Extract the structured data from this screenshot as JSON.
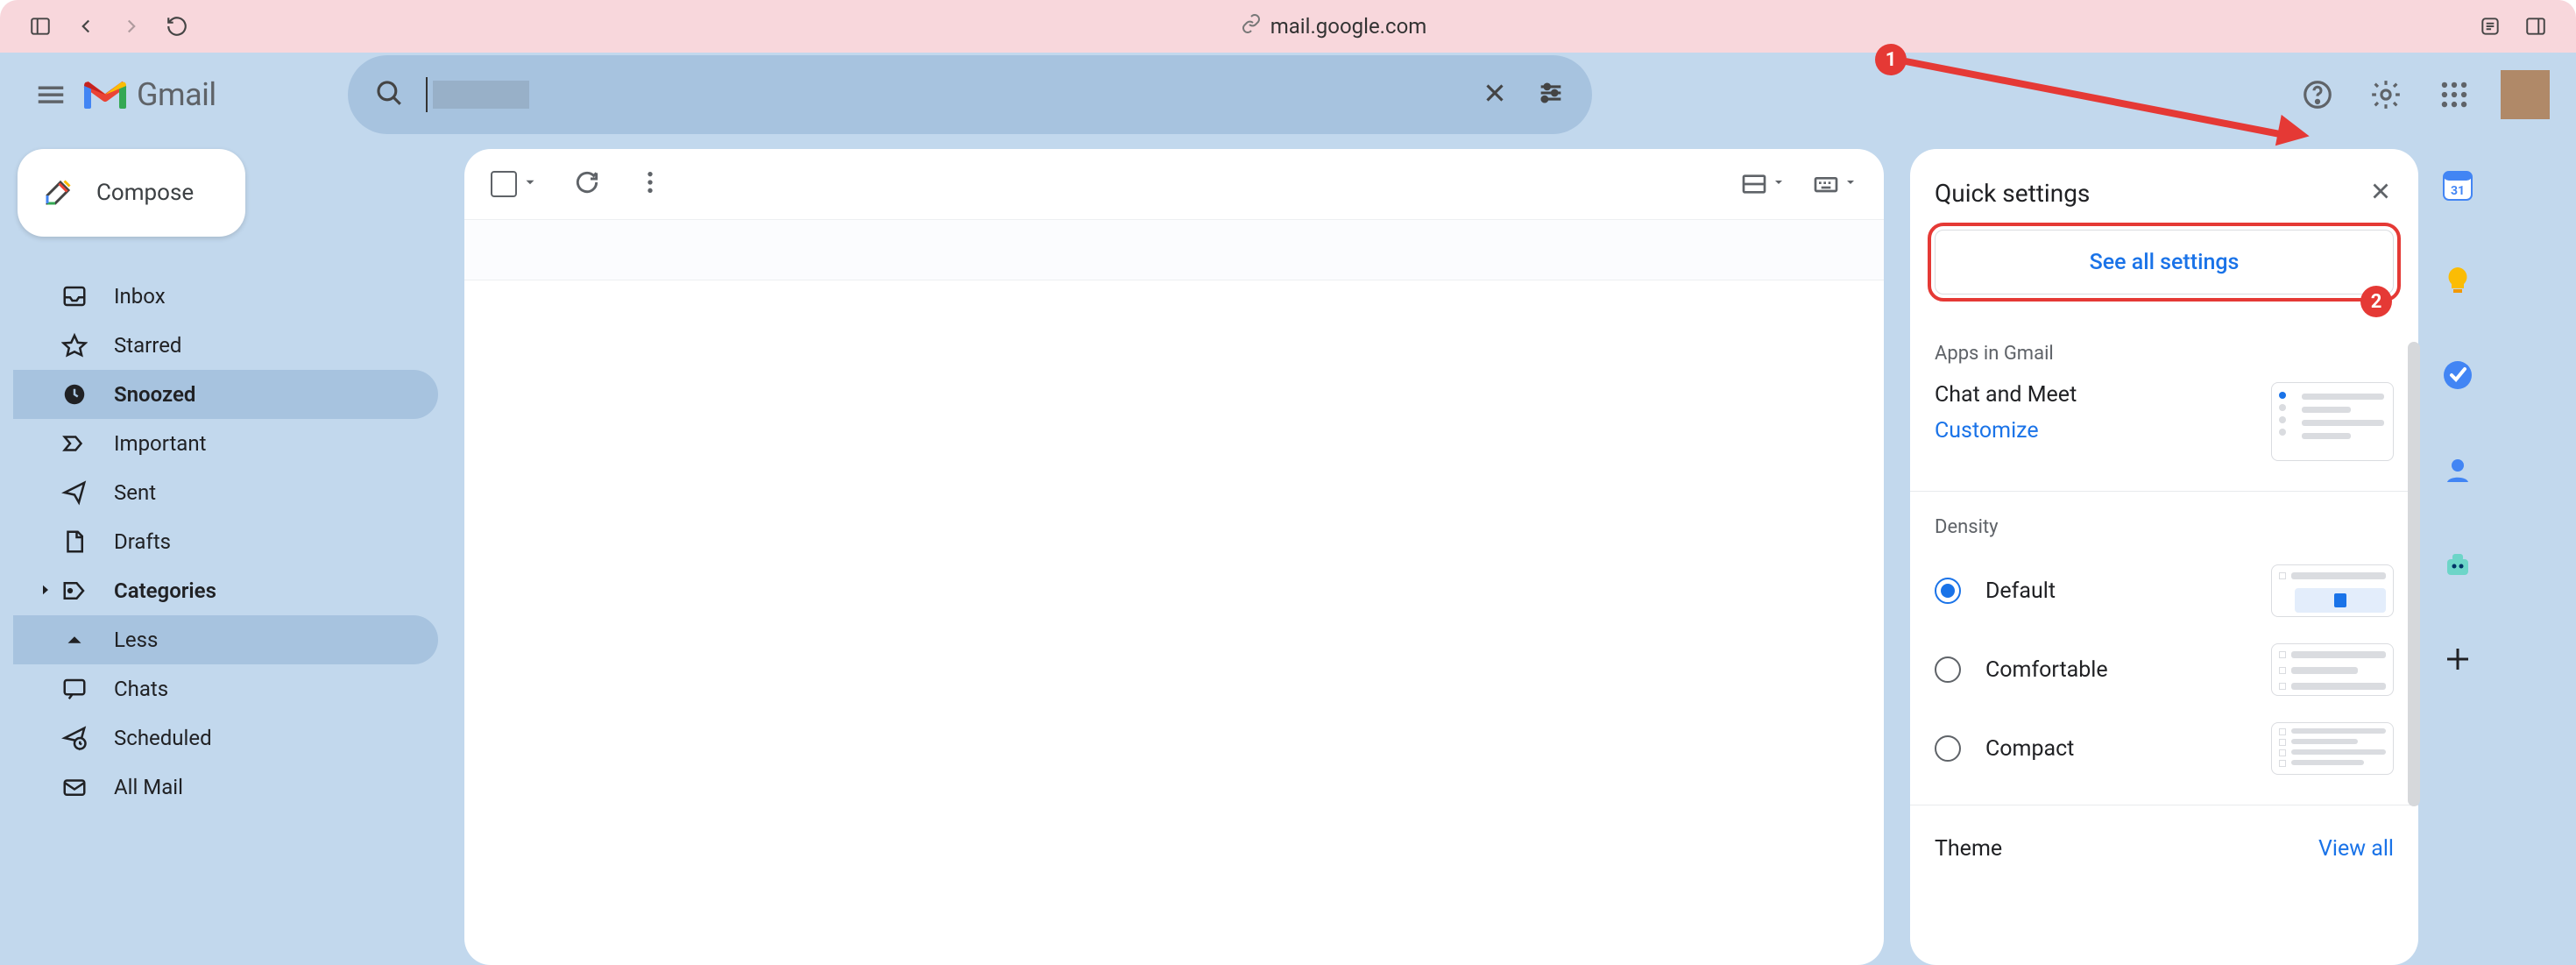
{
  "browser": {
    "url_domain": "mail.google.com"
  },
  "app": {
    "name": "Gmail"
  },
  "compose": {
    "label": "Compose"
  },
  "nav": {
    "items": [
      {
        "label": "Inbox"
      },
      {
        "label": "Starred"
      },
      {
        "label": "Snoozed"
      },
      {
        "label": "Important"
      },
      {
        "label": "Sent"
      },
      {
        "label": "Drafts"
      },
      {
        "label": "Categories"
      },
      {
        "label": "Less"
      },
      {
        "label": "Chats"
      },
      {
        "label": "Scheduled"
      },
      {
        "label": "All Mail"
      }
    ]
  },
  "quick_settings": {
    "title": "Quick settings",
    "see_all": "See all settings",
    "apps_label": "Apps in Gmail",
    "chat_meet": {
      "title": "Chat and Meet",
      "customize": "Customize"
    },
    "density": {
      "label": "Density",
      "options": {
        "default": "Default",
        "comfortable": "Comfortable",
        "compact": "Compact"
      },
      "selected": "Default"
    },
    "theme": {
      "label": "Theme",
      "view_all": "View all"
    }
  },
  "annotations": {
    "callout1": "1",
    "callout2": "2"
  }
}
